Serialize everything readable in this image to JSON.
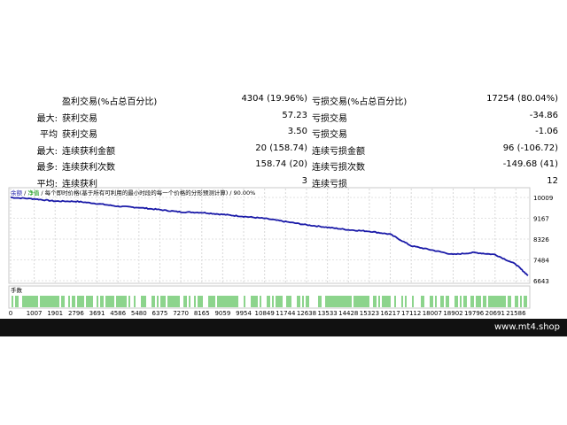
{
  "stats": {
    "rows": [
      {
        "prefix": "",
        "label": "盈利交易(%占总百分比)",
        "value": "4304 (19.96%)",
        "label2": "亏损交易(%占总百分比)",
        "value2": "17254 (80.04%)"
      },
      {
        "prefix": "最大:",
        "label": "获利交易",
        "value": "57.23",
        "label2": "亏损交易",
        "value2": "-34.86"
      },
      {
        "prefix": "平均",
        "label": "获利交易",
        "value": "3.50",
        "label2": "亏损交易",
        "value2": "-1.06"
      },
      {
        "prefix": "最大:",
        "label": "连续获利金额",
        "value": "20 (158.74)",
        "label2": "连续亏损金额",
        "value2": "96 (-106.72)"
      },
      {
        "prefix": "最多:",
        "label": "连续获利次数",
        "value": "158.74 (20)",
        "label2": "连续亏损次数",
        "value2": "-149.68 (41)"
      },
      {
        "prefix": "平均:",
        "label": "连续获利",
        "value": "3",
        "label2": "连续亏损",
        "value2": "12"
      }
    ]
  },
  "chart": {
    "legend": {
      "balance": "余额",
      "equity": "净值",
      "description": "每个即时价格(基于所有可利用的最小时段的每一个价格的分形预测计算) / 90.00%"
    },
    "volume_label": "手数",
    "balance_color": "#1a1aa8",
    "volume_color": "#00a000"
  },
  "chart_data": {
    "type": "line",
    "ylim": [
      6643,
      10009
    ],
    "y_ticks": [
      "10009",
      "9167",
      "8326",
      "7484",
      "6643"
    ],
    "x_ticks": [
      "0",
      "1007",
      "1901",
      "2796",
      "3691",
      "4586",
      "5480",
      "6375",
      "7270",
      "8165",
      "9059",
      "9954",
      "10849",
      "11744",
      "12638",
      "13533",
      "14428",
      "15323",
      "16217",
      "17112",
      "18007",
      "18902",
      "19796",
      "20691",
      "21586"
    ],
    "series": [
      {
        "x": [
          0,
          1007,
          1901,
          2796,
          3691,
          4586,
          5480,
          6375,
          7270,
          8165,
          9059,
          9954,
          10849,
          11744,
          12638,
          13533,
          14428,
          15323,
          16217,
          17112,
          18007,
          18902,
          19796,
          20691,
          21586,
          22100
        ],
        "values": [
          10009,
          9950,
          9860,
          9850,
          9760,
          9650,
          9600,
          9510,
          9420,
          9400,
          9320,
          9240,
          9160,
          9030,
          8900,
          8800,
          8700,
          8640,
          8520,
          8050,
          7880,
          7700,
          7780,
          7700,
          7300,
          6850
        ]
      }
    ]
  },
  "footer": {
    "text": "www.mt4.shop"
  }
}
